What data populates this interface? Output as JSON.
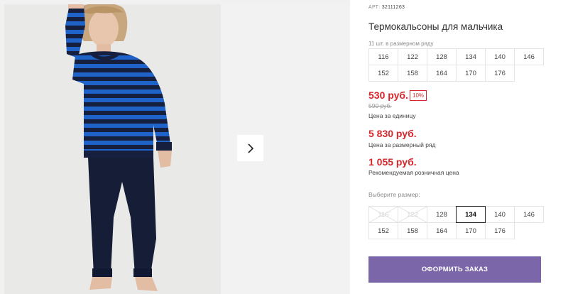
{
  "product": {
    "art_label": "АРТ:",
    "art_number": "32111263",
    "title": "Термокальсоны для мальчика"
  },
  "pack": {
    "note": "11 шт. в размерном ряду",
    "sizes": [
      "116",
      "122",
      "128",
      "134",
      "140",
      "146",
      "152",
      "158",
      "164",
      "170",
      "176"
    ]
  },
  "pricing": {
    "unit_price": "530 руб.",
    "discount": "10%",
    "old_price": "590 руб.",
    "unit_label": "Цена за единицу",
    "pack_price": "5 830 руб.",
    "pack_label": "Цена за размерный ряд",
    "rrp_price": "1 055 руб.",
    "rrp_label": "Рекомендуемая розничная цена"
  },
  "size_select": {
    "label": "Выберите размер:",
    "selected": "134",
    "sizes": [
      {
        "label": "116",
        "available": false
      },
      {
        "label": "122",
        "available": false
      },
      {
        "label": "128",
        "available": true
      },
      {
        "label": "134",
        "available": true
      },
      {
        "label": "140",
        "available": true
      },
      {
        "label": "146",
        "available": true
      },
      {
        "label": "152",
        "available": true
      },
      {
        "label": "158",
        "available": true
      },
      {
        "label": "164",
        "available": true
      },
      {
        "label": "170",
        "available": true
      },
      {
        "label": "176",
        "available": true
      }
    ]
  },
  "actions": {
    "order_label": "ОФОРМИТЬ ЗАКАЗ"
  },
  "colors": {
    "price_red": "#d7272b",
    "order_button": "#7a66a8",
    "shirt_blue": "#1f63c9",
    "shirt_navy": "#161f3d",
    "pants_navy": "#151d37"
  },
  "icons": {
    "gallery_next": "chevron-right-icon"
  }
}
